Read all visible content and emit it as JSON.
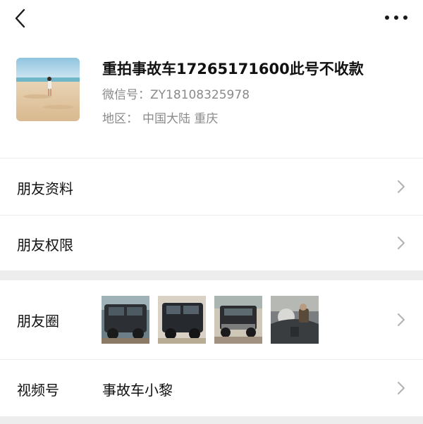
{
  "topbar": {
    "back_icon": "chevron-left-icon",
    "more_icon": "more-horizontal-icon"
  },
  "profile": {
    "nickname": "重拍事故车17265171600此号不收款",
    "wechat_id_label": "微信号：",
    "wechat_id_value": "ZY18108325978",
    "region_label": "地区：",
    "region_value": "中国大陆  重庆"
  },
  "menu": {
    "friend_profile": "朋友资料",
    "friend_permissions": "朋友权限",
    "moments": "朋友圈",
    "channels": "视频号",
    "channels_value": "事故车小黎"
  },
  "colors": {
    "text_primary": "#111111",
    "text_secondary": "#8a8a8a",
    "divider": "#ececec",
    "section_gap": "#ededed",
    "chevron": "#b2b2b2"
  }
}
